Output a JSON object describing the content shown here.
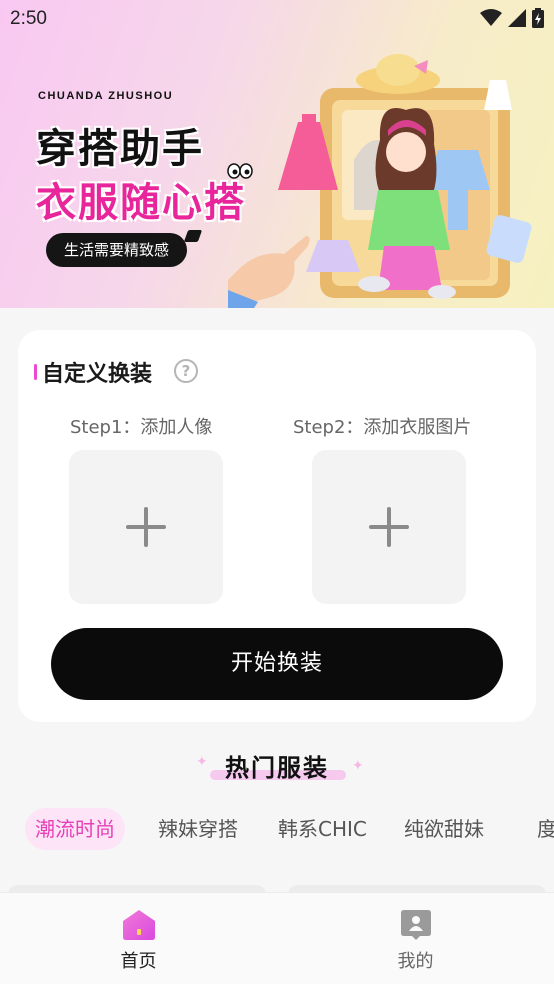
{
  "status_bar": {
    "time": "2:50"
  },
  "banner": {
    "brand_en": "CHUANDA ZHUSHOU",
    "title": "穿搭助手",
    "subtitle": "衣服随心搭",
    "tagline": "生活需要精致感"
  },
  "custom_section": {
    "title": "自定义换装",
    "help_icon": "?",
    "step1_label": "Step1：添加人像",
    "step2_label": "Step2：添加衣服图片",
    "start_button": "开始换装"
  },
  "hot_section": {
    "title": "热门服装",
    "tabs": [
      {
        "label": "潮流时尚",
        "active": true
      },
      {
        "label": "辣妹穿搭",
        "active": false
      },
      {
        "label": "韩系CHIC",
        "active": false
      },
      {
        "label": "纯欲甜妹",
        "active": false
      },
      {
        "label": "度",
        "active": false
      }
    ]
  },
  "bottom_nav": {
    "items": [
      {
        "label": "首页",
        "icon": "home-icon",
        "active": true
      },
      {
        "label": "我的",
        "icon": "profile-icon",
        "active": false
      }
    ]
  },
  "colors": {
    "accent": "#e83fb9",
    "tab_active_bg": "#fde4f6",
    "button_bg": "#0b0b0b"
  }
}
